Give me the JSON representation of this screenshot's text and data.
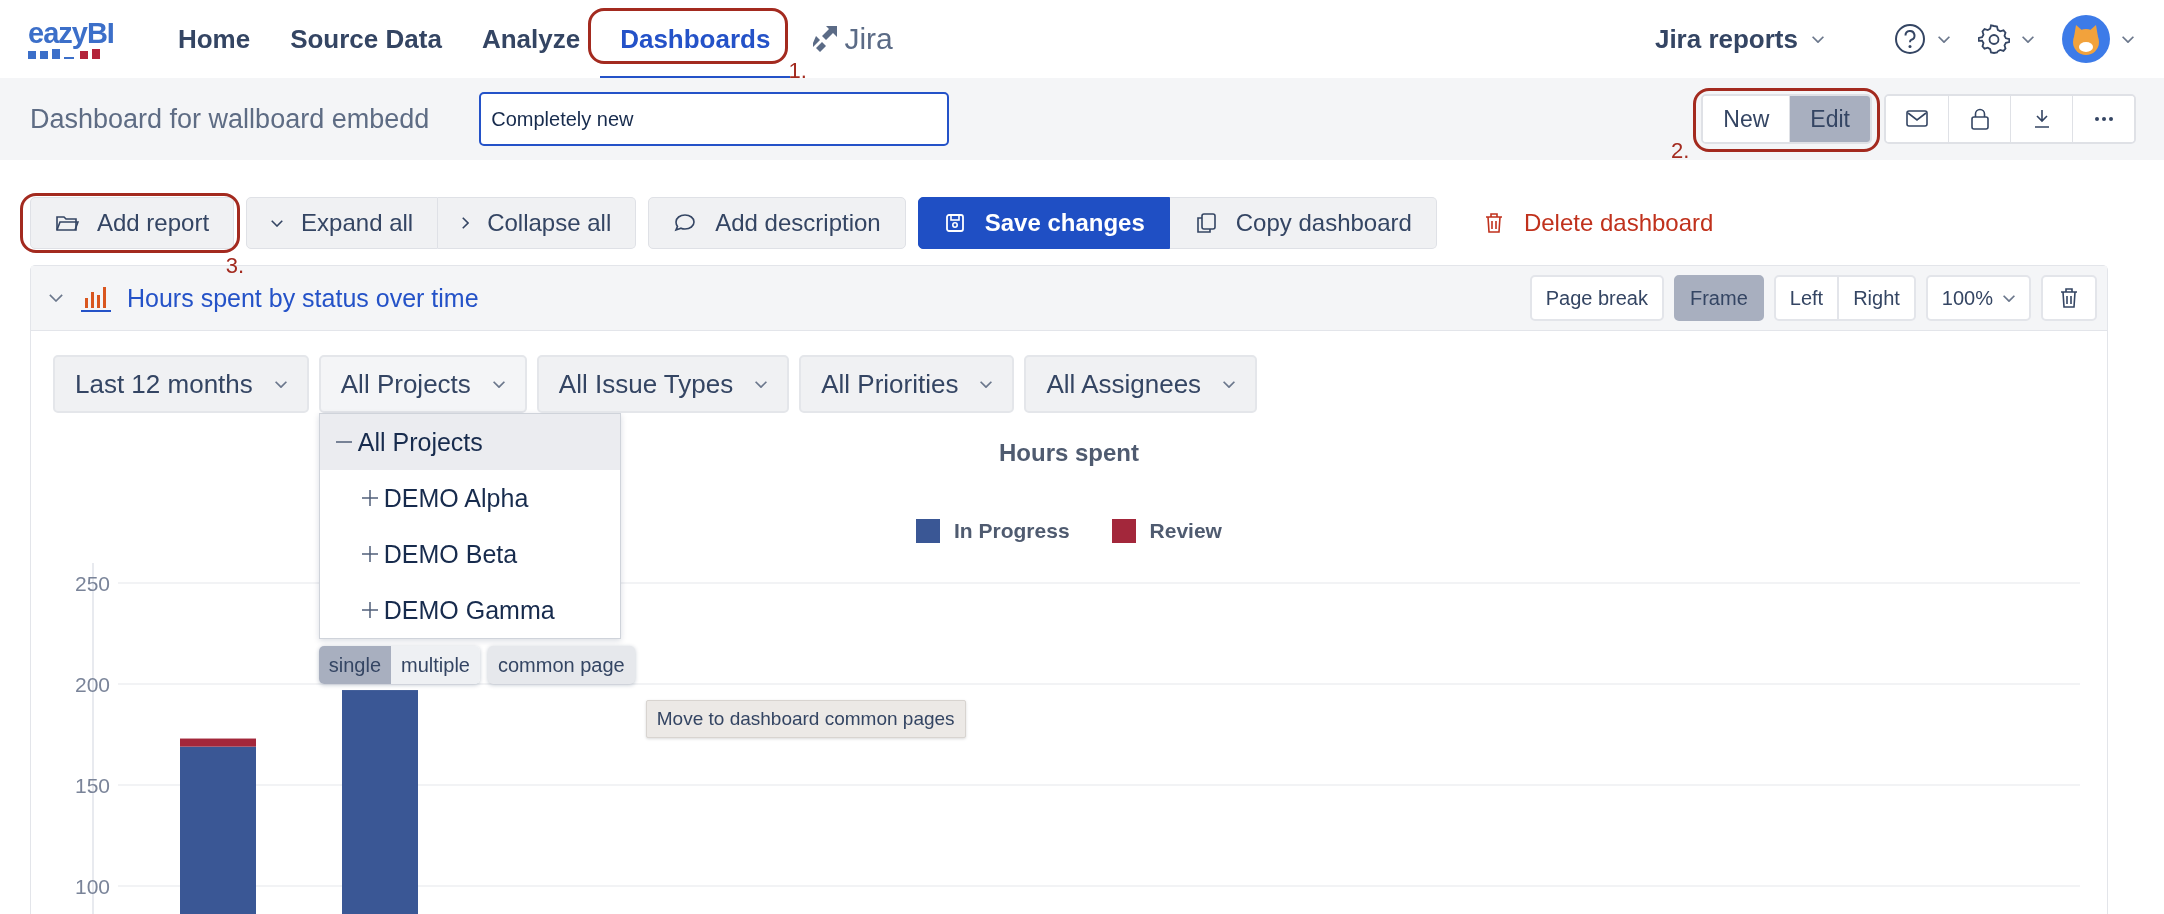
{
  "nav": {
    "logo": "eazyBI",
    "items": [
      {
        "label": "Home",
        "selected": false
      },
      {
        "label": "Source Data",
        "selected": false
      },
      {
        "label": "Analyze",
        "selected": false
      },
      {
        "label": "Dashboards",
        "selected": true,
        "annotation": "1."
      }
    ],
    "product": "Jira",
    "account_menu": "Jira reports"
  },
  "dashboard_bar": {
    "title": "Dashboard for wallboard embedd",
    "name_field": {
      "value": "Completely new"
    },
    "mode_buttons": [
      {
        "label": "New",
        "selected": false
      },
      {
        "label": "Edit",
        "selected": true
      }
    ],
    "mode_annotation": "2."
  },
  "toolbar": {
    "groups": [
      [
        {
          "label": "Add report",
          "kind": "folder",
          "annotation": "3."
        }
      ],
      [
        {
          "label": "Expand all",
          "kind": "expand"
        },
        {
          "label": "Collapse all",
          "kind": "collapse"
        }
      ],
      [
        {
          "label": "Add description",
          "kind": "comment"
        }
      ],
      [
        {
          "label": "Save changes",
          "kind": "primary"
        },
        {
          "label": "Copy dashboard",
          "kind": "copy"
        }
      ],
      [
        {
          "label": "Delete dashboard",
          "kind": "danger"
        }
      ]
    ]
  },
  "report": {
    "title": "Hours spent by status over time",
    "expanded": true,
    "options": [
      {
        "label": "Page break",
        "selected": false
      },
      {
        "label": "Frame",
        "selected": true
      }
    ],
    "align": [
      {
        "label": "Left",
        "selected": false
      },
      {
        "label": "Right",
        "selected": false
      }
    ],
    "zoom": "100%",
    "filters": [
      {
        "label": "Last 12 months",
        "expanded": false
      },
      {
        "label": "All Projects",
        "expanded": true
      },
      {
        "label": "All Issue Types",
        "expanded": false
      },
      {
        "label": "All Priorities",
        "expanded": false
      },
      {
        "label": "All Assignees",
        "expanded": false
      }
    ],
    "project_menu": [
      {
        "label": "All Projects",
        "selected": true,
        "expanded": true,
        "children": [
          {
            "label": "DEMO Alpha",
            "selected": false,
            "expanded": false
          },
          {
            "label": "DEMO Beta",
            "selected": false,
            "expanded": false
          },
          {
            "label": "DEMO Gamma",
            "selected": false,
            "expanded": false
          }
        ]
      }
    ],
    "page_modes": [
      {
        "label": "single",
        "selected": true
      },
      {
        "label": "multiple",
        "selected": false
      }
    ],
    "common_page": "common page",
    "tooltip": "Move to dashboard common pages",
    "chart_data": {
      "type": "bar",
      "title": "Hours spent",
      "stacked": true,
      "legend": "top",
      "grid": true,
      "ylim": [
        0,
        250
      ],
      "yticks": [
        100,
        150,
        200,
        250
      ],
      "series": [
        {
          "name": "In Progress",
          "color": "#3a5795",
          "values": [
            169,
            197
          ]
        },
        {
          "name": "Review",
          "color": "#a3273b",
          "values": [
            4,
            null
          ]
        }
      ]
    }
  }
}
